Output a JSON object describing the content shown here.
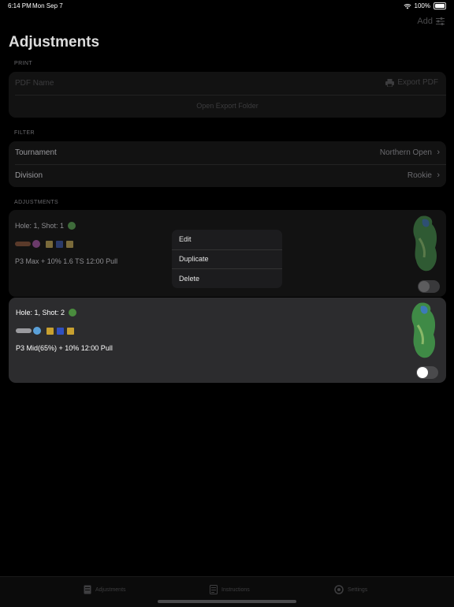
{
  "status": {
    "time": "6:14 PM",
    "date": "Mon Sep 7",
    "battery": "100%"
  },
  "toolbar": {
    "add_label": "Add"
  },
  "page_title": "Adjustments",
  "print": {
    "section_label": "PRINT",
    "pdf_placeholder": "PDF Name",
    "export_label": "Export PDF",
    "open_folder_label": "Open Export Folder"
  },
  "filter": {
    "section_label": "FILTER",
    "rows": [
      {
        "label": "Tournament",
        "value": "Northern Open"
      },
      {
        "label": "Division",
        "value": "Rookie"
      }
    ]
  },
  "adjustments": {
    "section_label": "ADJUSTMENTS",
    "items": [
      {
        "title": "Hole: 1, Shot: 1",
        "description": "P3 Max + 10% 1.6 TS 12:00 Pull",
        "enabled": false
      },
      {
        "title": "Hole: 1, Shot: 2",
        "description": "P3 Mid(65%) + 10% 12:00 Pull",
        "enabled": false
      }
    ]
  },
  "context_menu": {
    "edit": "Edit",
    "duplicate": "Duplicate",
    "delete": "Delete"
  },
  "tabs": [
    {
      "label": "Adjustments"
    },
    {
      "label": "Instructions"
    },
    {
      "label": "Settings"
    }
  ],
  "colors": {
    "background": "#000000",
    "card": "#121212",
    "card_active": "#2c2c2e",
    "menu": "#1c1c1e"
  }
}
